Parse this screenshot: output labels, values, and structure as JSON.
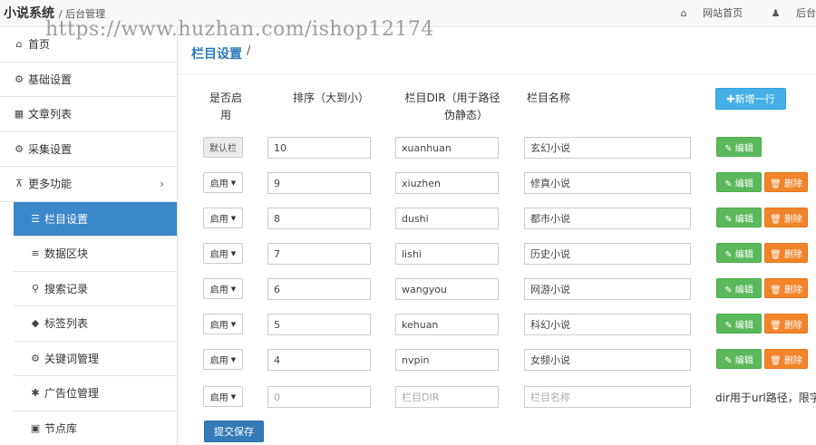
{
  "header": {
    "brand": "小说系统",
    "brand_sub": "/ 后台管理",
    "nav": [
      {
        "icon": "home-icon",
        "glyph": "⌂",
        "label": "网站首页"
      },
      {
        "icon": "user-icon",
        "glyph": "♟",
        "label": "后台"
      }
    ]
  },
  "watermark": "https://www.huzhan.com/ishop12174",
  "sidebar": {
    "items": [
      {
        "icon": "home-icon",
        "glyph": "⌂",
        "label": "首页",
        "sub": false
      },
      {
        "icon": "gear-icon",
        "glyph": "⚙",
        "label": "基础设置",
        "sub": false
      },
      {
        "icon": "table-icon",
        "glyph": "▦",
        "label": "文章列表",
        "sub": false
      },
      {
        "icon": "gears-icon",
        "glyph": "⚙",
        "label": "采集设置",
        "sub": false
      },
      {
        "icon": "sitemap-icon",
        "glyph": "⊼",
        "label": "更多功能",
        "sub": false,
        "expandable": true
      },
      {
        "icon": "list-icon",
        "glyph": "☰",
        "label": "栏目设置",
        "sub": true,
        "active": true
      },
      {
        "icon": "database-icon",
        "glyph": "≡",
        "label": "数据区块",
        "sub": true
      },
      {
        "icon": "search-icon",
        "glyph": "⚲",
        "label": "搜索记录",
        "sub": true
      },
      {
        "icon": "tag-icon",
        "glyph": "◆",
        "label": "标签列表",
        "sub": true
      },
      {
        "icon": "gears-icon",
        "glyph": "⚙",
        "label": "关键词管理",
        "sub": true
      },
      {
        "icon": "ad-icon",
        "glyph": "✱",
        "label": "广告位管理",
        "sub": true
      },
      {
        "icon": "cube-icon",
        "glyph": "▣",
        "label": "节点库",
        "sub": true
      }
    ]
  },
  "breadcrumb": {
    "title": "栏目设置",
    "sep": "/"
  },
  "table": {
    "headers": {
      "enabled_l1": "是否启",
      "enabled_l2": "用",
      "sort": "排序（大到小）",
      "dir_l1": "栏目DIR（用于路径",
      "dir_l2": "伪静态）",
      "name": "栏目名称"
    },
    "add_button": "✚新增一行",
    "edit_label": "✎ 编辑",
    "delete_label": "🗑 删除",
    "rows": [
      {
        "status": "默认栏",
        "static": true,
        "sort": "10",
        "dir": "xuanhuan",
        "name": "玄幻小说",
        "deletable": false
      },
      {
        "status": "启用",
        "sort": "9",
        "dir": "xiuzhen",
        "name": "修真小说",
        "deletable": true
      },
      {
        "status": "启用",
        "sort": "8",
        "dir": "dushi",
        "name": "都市小说",
        "deletable": true
      },
      {
        "status": "启用",
        "sort": "7",
        "dir": "lishi",
        "name": "历史小说",
        "deletable": true
      },
      {
        "status": "启用",
        "sort": "6",
        "dir": "wangyou",
        "name": "网游小说",
        "deletable": true
      },
      {
        "status": "启用",
        "sort": "5",
        "dir": "kehuan",
        "name": "科幻小说",
        "deletable": true
      },
      {
        "status": "启用",
        "sort": "4",
        "dir": "nvpin",
        "name": "女频小说",
        "deletable": true
      }
    ],
    "new_row": {
      "status": "启用",
      "sort_placeholder": "0",
      "dir_placeholder": "栏目DIR",
      "name_placeholder": "栏目名称",
      "note": "dir用于url路径，限字"
    },
    "submit_label": "提交保存"
  },
  "colors": {
    "active": "#3a87c9",
    "edit": "#5cb85c",
    "delete": "#f0852b",
    "add": "#45b0e7",
    "submit": "#337ab7"
  }
}
